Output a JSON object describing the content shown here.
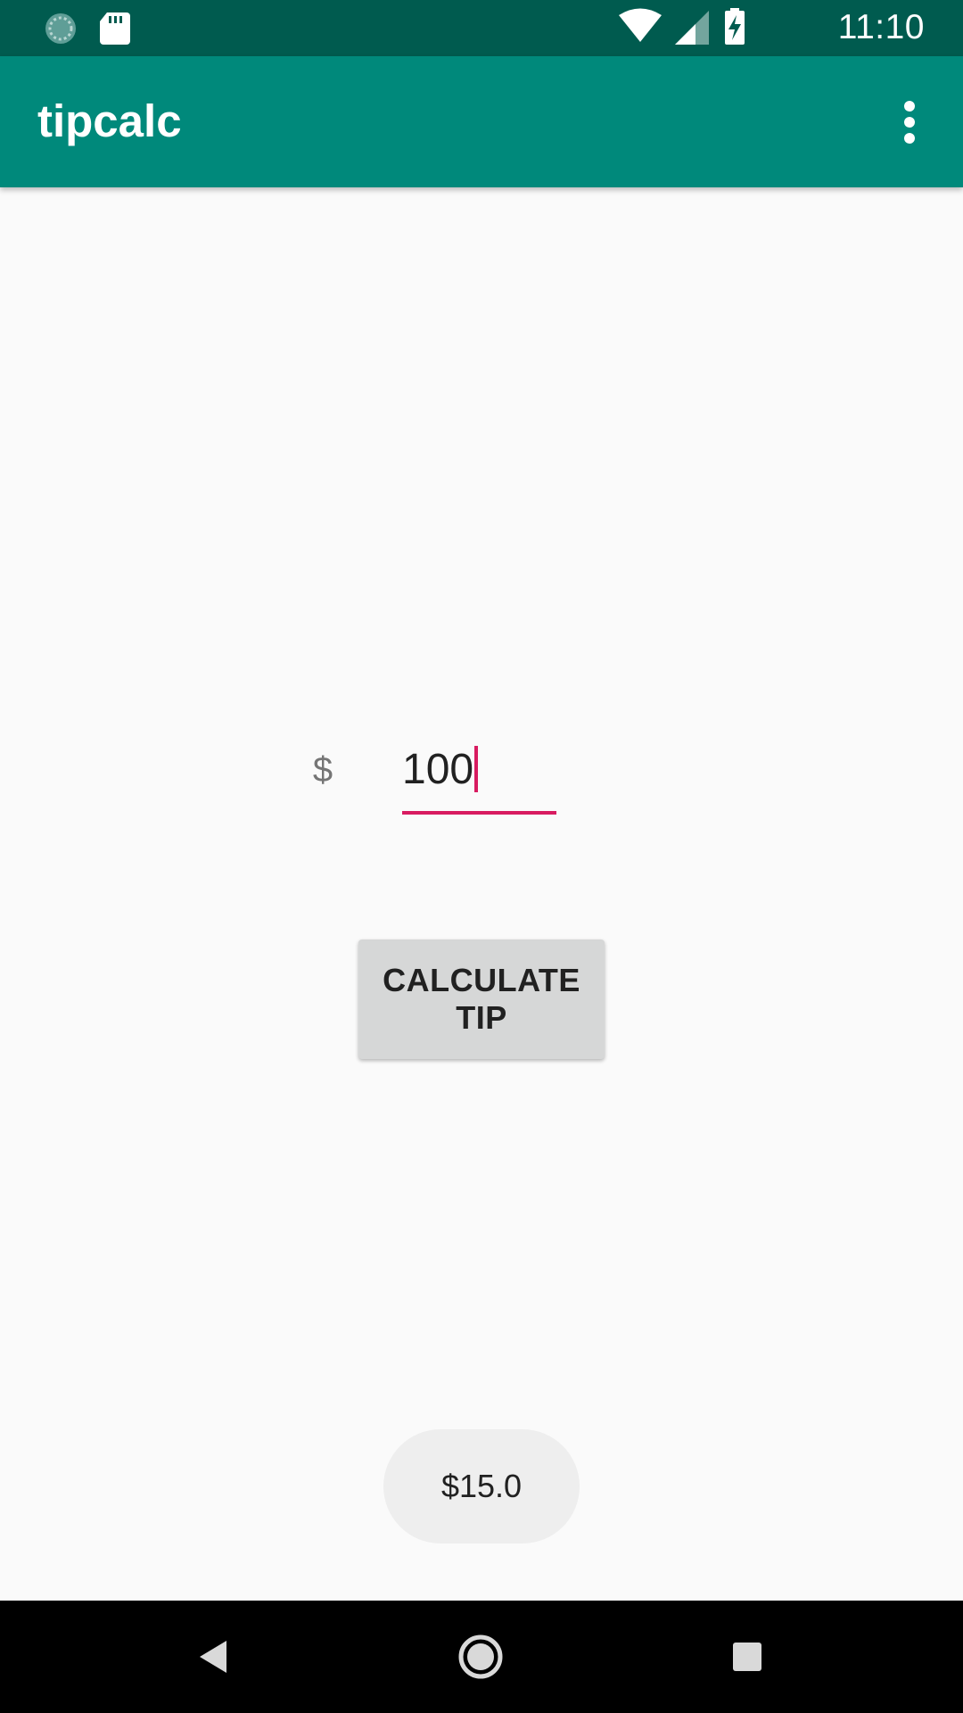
{
  "status_bar": {
    "time": "11:10",
    "icons": [
      "sync-icon",
      "sd-card-icon",
      "wifi-icon",
      "signal-icon",
      "battery-charging-icon"
    ]
  },
  "app_bar": {
    "title": "tipcalc",
    "menu_icon": "more-vert-icon"
  },
  "form": {
    "currency_symbol": "$",
    "amount_value": "100",
    "calculate_button_label_line1": "CALCULATE",
    "calculate_button_label_line2": "TIP"
  },
  "toast": {
    "message": "$15.0"
  },
  "nav_bar": {
    "icons": [
      "back-icon",
      "home-icon",
      "recents-icon"
    ]
  },
  "colors": {
    "status_bar": "#005b4f",
    "app_bar": "#00897b",
    "accent": "#d81b60",
    "background": "#fafafa",
    "button": "#d6d7d7"
  }
}
